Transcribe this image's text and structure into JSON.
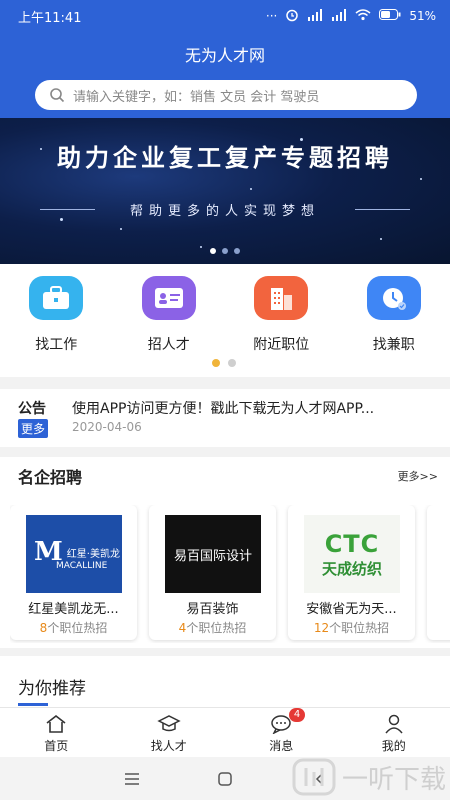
{
  "status_bar": {
    "time": "上午11:41",
    "dots": "···",
    "battery": "51%"
  },
  "app": {
    "title": "无为人才网"
  },
  "search": {
    "placeholder": "请输入关键字，如：销售 文员 会计 驾驶员",
    "icon": "search-icon"
  },
  "banner": {
    "title": "助力企业复工复产专题招聘",
    "subtitle": "帮助更多的人实现梦想"
  },
  "quick_actions": [
    {
      "label": "找工作",
      "icon": "briefcase-icon",
      "color": "#35b3ee"
    },
    {
      "label": "招人才",
      "icon": "id-card-icon",
      "color": "#8b62e6"
    },
    {
      "label": "附近职位",
      "icon": "building-icon",
      "color": "#f2643e"
    },
    {
      "label": "找兼职",
      "icon": "clock-icon",
      "color": "#3f86f5"
    }
  ],
  "notice": {
    "label": "公告",
    "more": "更多",
    "text": "使用APP访问更方便！戳此下载无为人才网APP...",
    "date": "2020-04-06"
  },
  "featured": {
    "title": "名企招聘",
    "more": "更多>>",
    "companies": [
      {
        "name": "红星美凯龙无...",
        "count": "8",
        "suffix": "个职位热招",
        "logo_line1": "红星·美凯龙",
        "logo_line2": "MACALLINE"
      },
      {
        "name": "易百装饰",
        "count": "4",
        "suffix": "个职位热招",
        "logo_line1": "易百国际设计"
      },
      {
        "name": "安徽省无为天...",
        "count": "12",
        "suffix": "个职位热招",
        "logo_line1": "CTC",
        "logo_line2": "天成纺织"
      }
    ]
  },
  "recommend": {
    "title": "为你推荐"
  },
  "tabs": [
    {
      "label": "首页",
      "icon": "home-icon"
    },
    {
      "label": "找人才",
      "icon": "graduation-cap-icon"
    },
    {
      "label": "消息",
      "icon": "message-icon",
      "badge": "4"
    },
    {
      "label": "我的",
      "icon": "person-icon"
    }
  ],
  "watermark": {
    "text": "一听下载"
  },
  "colors": {
    "brand": "#2d62d6",
    "accent": "#f0b43a",
    "count": "#e88a1a",
    "badge": "#e53935"
  }
}
